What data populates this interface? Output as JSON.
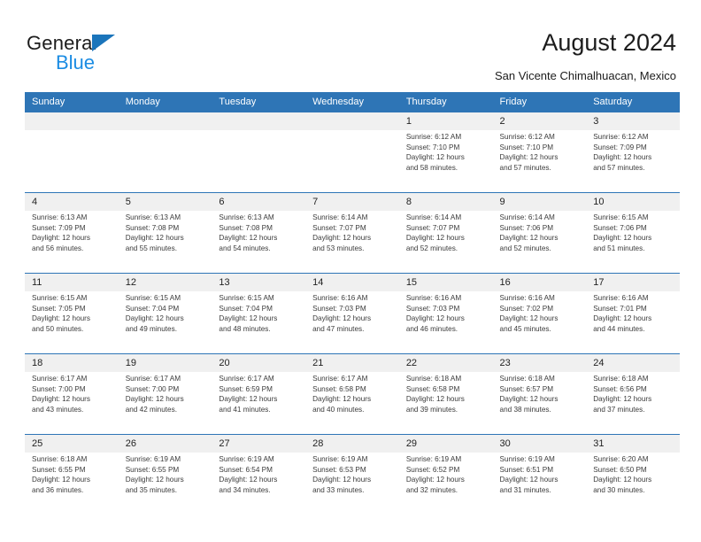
{
  "logo": {
    "word_one": "General",
    "word_two": "Blue",
    "triangle_color": "#1b75bb",
    "word_two_color": "#1b8ce3",
    "icon": "general-blue-triangle-logo"
  },
  "header": {
    "title": "August 2024",
    "subtitle": "San Vicente Chimalhuacan, Mexico"
  },
  "theme": {
    "header_blue": "#2e75b6",
    "date_strip_gray": "#f0f0f0",
    "body_text": "#3b3b3b",
    "page_background": "#ffffff"
  },
  "weekday_headers": [
    "Sunday",
    "Monday",
    "Tuesday",
    "Wednesday",
    "Thursday",
    "Friday",
    "Saturday"
  ],
  "weeks": [
    {
      "days": [
        {
          "date": "",
          "sunrise": "",
          "sunset": "",
          "daylight_a": "",
          "daylight_b": "",
          "empty": true
        },
        {
          "date": "",
          "sunrise": "",
          "sunset": "",
          "daylight_a": "",
          "daylight_b": "",
          "empty": true
        },
        {
          "date": "",
          "sunrise": "",
          "sunset": "",
          "daylight_a": "",
          "daylight_b": "",
          "empty": true
        },
        {
          "date": "",
          "sunrise": "",
          "sunset": "",
          "daylight_a": "",
          "daylight_b": "",
          "empty": true
        },
        {
          "date": "1",
          "sunrise": "Sunrise: 6:12 AM",
          "sunset": "Sunset: 7:10 PM",
          "daylight_a": "Daylight: 12 hours",
          "daylight_b": "and 58 minutes.",
          "empty": false
        },
        {
          "date": "2",
          "sunrise": "Sunrise: 6:12 AM",
          "sunset": "Sunset: 7:10 PM",
          "daylight_a": "Daylight: 12 hours",
          "daylight_b": "and 57 minutes.",
          "empty": false
        },
        {
          "date": "3",
          "sunrise": "Sunrise: 6:12 AM",
          "sunset": "Sunset: 7:09 PM",
          "daylight_a": "Daylight: 12 hours",
          "daylight_b": "and 57 minutes.",
          "empty": false
        }
      ]
    },
    {
      "days": [
        {
          "date": "4",
          "sunrise": "Sunrise: 6:13 AM",
          "sunset": "Sunset: 7:09 PM",
          "daylight_a": "Daylight: 12 hours",
          "daylight_b": "and 56 minutes.",
          "empty": false
        },
        {
          "date": "5",
          "sunrise": "Sunrise: 6:13 AM",
          "sunset": "Sunset: 7:08 PM",
          "daylight_a": "Daylight: 12 hours",
          "daylight_b": "and 55 minutes.",
          "empty": false
        },
        {
          "date": "6",
          "sunrise": "Sunrise: 6:13 AM",
          "sunset": "Sunset: 7:08 PM",
          "daylight_a": "Daylight: 12 hours",
          "daylight_b": "and 54 minutes.",
          "empty": false
        },
        {
          "date": "7",
          "sunrise": "Sunrise: 6:14 AM",
          "sunset": "Sunset: 7:07 PM",
          "daylight_a": "Daylight: 12 hours",
          "daylight_b": "and 53 minutes.",
          "empty": false
        },
        {
          "date": "8",
          "sunrise": "Sunrise: 6:14 AM",
          "sunset": "Sunset: 7:07 PM",
          "daylight_a": "Daylight: 12 hours",
          "daylight_b": "and 52 minutes.",
          "empty": false
        },
        {
          "date": "9",
          "sunrise": "Sunrise: 6:14 AM",
          "sunset": "Sunset: 7:06 PM",
          "daylight_a": "Daylight: 12 hours",
          "daylight_b": "and 52 minutes.",
          "empty": false
        },
        {
          "date": "10",
          "sunrise": "Sunrise: 6:15 AM",
          "sunset": "Sunset: 7:06 PM",
          "daylight_a": "Daylight: 12 hours",
          "daylight_b": "and 51 minutes.",
          "empty": false
        }
      ]
    },
    {
      "days": [
        {
          "date": "11",
          "sunrise": "Sunrise: 6:15 AM",
          "sunset": "Sunset: 7:05 PM",
          "daylight_a": "Daylight: 12 hours",
          "daylight_b": "and 50 minutes.",
          "empty": false
        },
        {
          "date": "12",
          "sunrise": "Sunrise: 6:15 AM",
          "sunset": "Sunset: 7:04 PM",
          "daylight_a": "Daylight: 12 hours",
          "daylight_b": "and 49 minutes.",
          "empty": false
        },
        {
          "date": "13",
          "sunrise": "Sunrise: 6:15 AM",
          "sunset": "Sunset: 7:04 PM",
          "daylight_a": "Daylight: 12 hours",
          "daylight_b": "and 48 minutes.",
          "empty": false
        },
        {
          "date": "14",
          "sunrise": "Sunrise: 6:16 AM",
          "sunset": "Sunset: 7:03 PM",
          "daylight_a": "Daylight: 12 hours",
          "daylight_b": "and 47 minutes.",
          "empty": false
        },
        {
          "date": "15",
          "sunrise": "Sunrise: 6:16 AM",
          "sunset": "Sunset: 7:03 PM",
          "daylight_a": "Daylight: 12 hours",
          "daylight_b": "and 46 minutes.",
          "empty": false
        },
        {
          "date": "16",
          "sunrise": "Sunrise: 6:16 AM",
          "sunset": "Sunset: 7:02 PM",
          "daylight_a": "Daylight: 12 hours",
          "daylight_b": "and 45 minutes.",
          "empty": false
        },
        {
          "date": "17",
          "sunrise": "Sunrise: 6:16 AM",
          "sunset": "Sunset: 7:01 PM",
          "daylight_a": "Daylight: 12 hours",
          "daylight_b": "and 44 minutes.",
          "empty": false
        }
      ]
    },
    {
      "days": [
        {
          "date": "18",
          "sunrise": "Sunrise: 6:17 AM",
          "sunset": "Sunset: 7:00 PM",
          "daylight_a": "Daylight: 12 hours",
          "daylight_b": "and 43 minutes.",
          "empty": false
        },
        {
          "date": "19",
          "sunrise": "Sunrise: 6:17 AM",
          "sunset": "Sunset: 7:00 PM",
          "daylight_a": "Daylight: 12 hours",
          "daylight_b": "and 42 minutes.",
          "empty": false
        },
        {
          "date": "20",
          "sunrise": "Sunrise: 6:17 AM",
          "sunset": "Sunset: 6:59 PM",
          "daylight_a": "Daylight: 12 hours",
          "daylight_b": "and 41 minutes.",
          "empty": false
        },
        {
          "date": "21",
          "sunrise": "Sunrise: 6:17 AM",
          "sunset": "Sunset: 6:58 PM",
          "daylight_a": "Daylight: 12 hours",
          "daylight_b": "and 40 minutes.",
          "empty": false
        },
        {
          "date": "22",
          "sunrise": "Sunrise: 6:18 AM",
          "sunset": "Sunset: 6:58 PM",
          "daylight_a": "Daylight: 12 hours",
          "daylight_b": "and 39 minutes.",
          "empty": false
        },
        {
          "date": "23",
          "sunrise": "Sunrise: 6:18 AM",
          "sunset": "Sunset: 6:57 PM",
          "daylight_a": "Daylight: 12 hours",
          "daylight_b": "and 38 minutes.",
          "empty": false
        },
        {
          "date": "24",
          "sunrise": "Sunrise: 6:18 AM",
          "sunset": "Sunset: 6:56 PM",
          "daylight_a": "Daylight: 12 hours",
          "daylight_b": "and 37 minutes.",
          "empty": false
        }
      ]
    },
    {
      "days": [
        {
          "date": "25",
          "sunrise": "Sunrise: 6:18 AM",
          "sunset": "Sunset: 6:55 PM",
          "daylight_a": "Daylight: 12 hours",
          "daylight_b": "and 36 minutes.",
          "empty": false
        },
        {
          "date": "26",
          "sunrise": "Sunrise: 6:19 AM",
          "sunset": "Sunset: 6:55 PM",
          "daylight_a": "Daylight: 12 hours",
          "daylight_b": "and 35 minutes.",
          "empty": false
        },
        {
          "date": "27",
          "sunrise": "Sunrise: 6:19 AM",
          "sunset": "Sunset: 6:54 PM",
          "daylight_a": "Daylight: 12 hours",
          "daylight_b": "and 34 minutes.",
          "empty": false
        },
        {
          "date": "28",
          "sunrise": "Sunrise: 6:19 AM",
          "sunset": "Sunset: 6:53 PM",
          "daylight_a": "Daylight: 12 hours",
          "daylight_b": "and 33 minutes.",
          "empty": false
        },
        {
          "date": "29",
          "sunrise": "Sunrise: 6:19 AM",
          "sunset": "Sunset: 6:52 PM",
          "daylight_a": "Daylight: 12 hours",
          "daylight_b": "and 32 minutes.",
          "empty": false
        },
        {
          "date": "30",
          "sunrise": "Sunrise: 6:19 AM",
          "sunset": "Sunset: 6:51 PM",
          "daylight_a": "Daylight: 12 hours",
          "daylight_b": "and 31 minutes.",
          "empty": false
        },
        {
          "date": "31",
          "sunrise": "Sunrise: 6:20 AM",
          "sunset": "Sunset: 6:50 PM",
          "daylight_a": "Daylight: 12 hours",
          "daylight_b": "and 30 minutes.",
          "empty": false
        }
      ]
    }
  ]
}
